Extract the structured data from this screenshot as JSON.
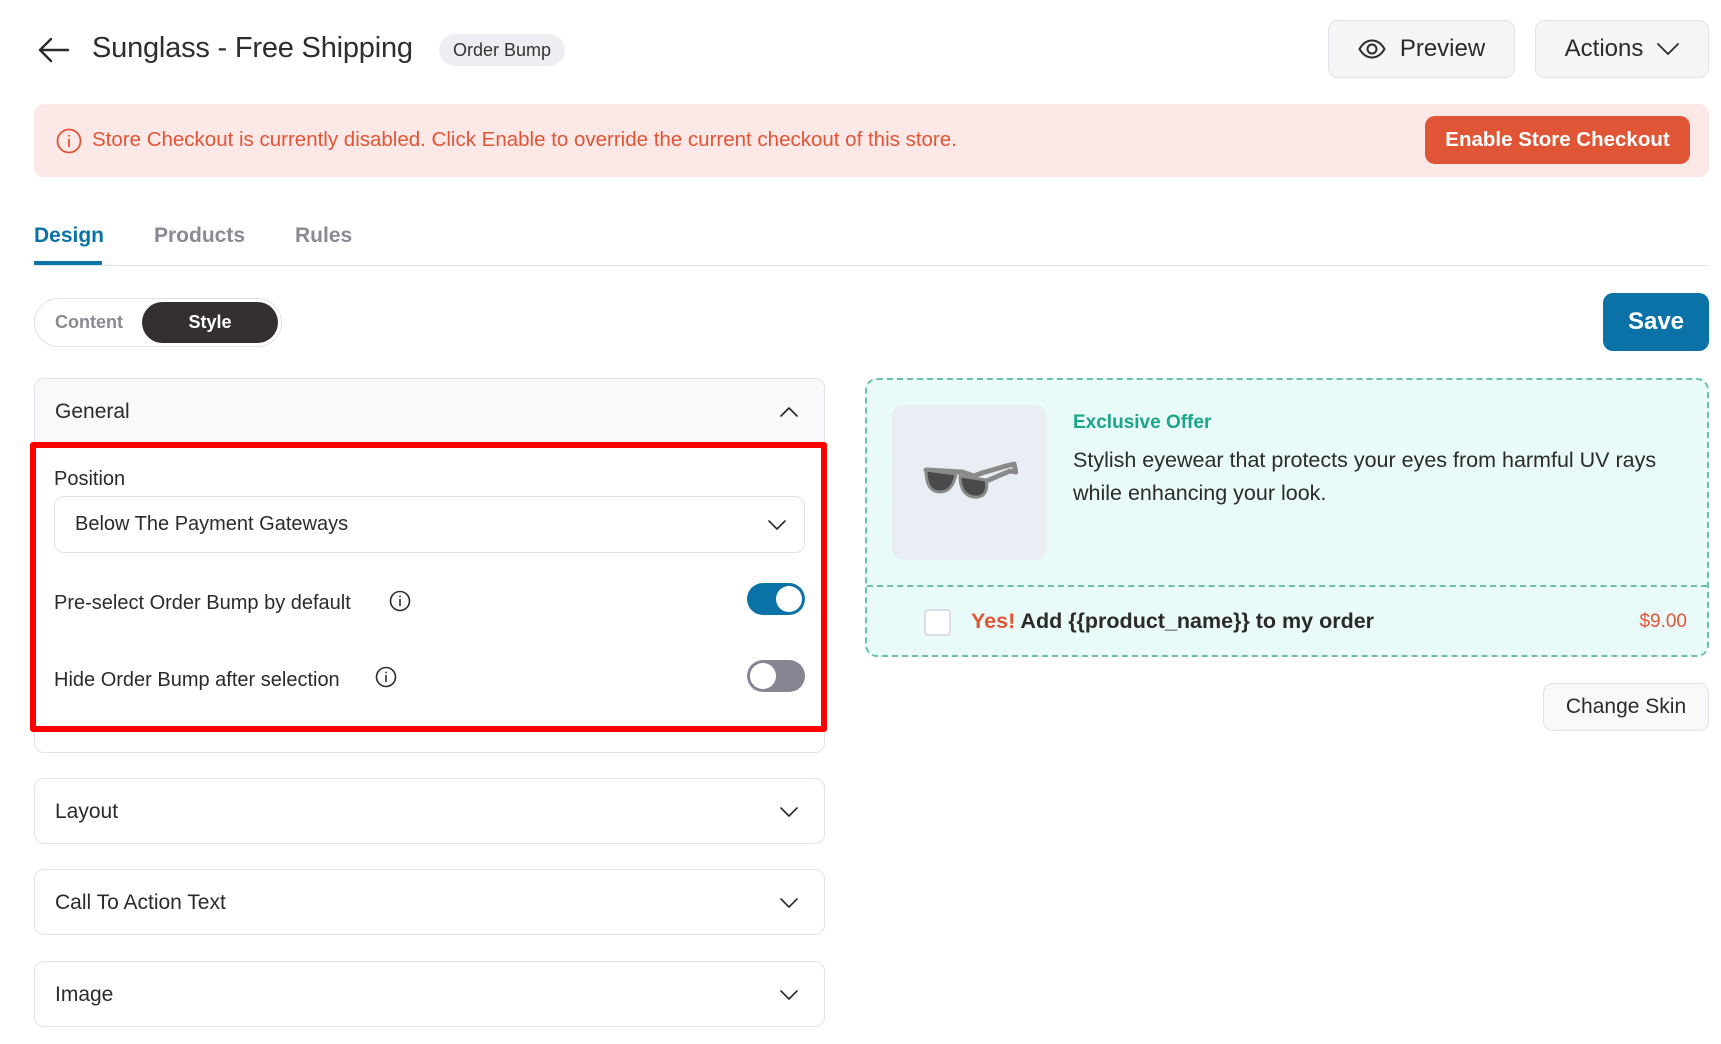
{
  "header": {
    "back_icon": "arrow-left-icon",
    "title": "Sunglass - Free Shipping",
    "badge": "Order Bump",
    "preview_label": "Preview",
    "preview_icon": "eye-icon",
    "actions_label": "Actions",
    "actions_icon": "chevron-down-icon"
  },
  "alert": {
    "icon": "info-circle-icon",
    "message": "Store Checkout is currently disabled. Click Enable to override the current checkout of this store.",
    "button_label": "Enable Store Checkout",
    "color": "#e05535",
    "background": "#fde8e8"
  },
  "tabs": [
    {
      "label": "Design",
      "active": true
    },
    {
      "label": "Products",
      "active": false
    },
    {
      "label": "Rules",
      "active": false
    }
  ],
  "mode_switch": {
    "options": [
      "Content",
      "Style"
    ],
    "selected": "Style"
  },
  "save_label": "Save",
  "panels": {
    "general": {
      "title": "General",
      "expanded": true,
      "position": {
        "label": "Position",
        "value": "Below The Payment Gateways"
      },
      "preselect": {
        "label": "Pre-select Order Bump by default",
        "enabled": true
      },
      "hide_after": {
        "label": "Hide Order Bump after selection",
        "enabled": false
      }
    },
    "layout": {
      "title": "Layout",
      "expanded": false
    },
    "cta": {
      "title": "Call To Action Text",
      "expanded": false
    },
    "image": {
      "title": "Image",
      "expanded": false
    }
  },
  "preview": {
    "product_image": "sunglasses",
    "offer_title": "Exclusive Offer",
    "description": "Stylish eyewear that protects your eyes from harmful UV rays while enhancing your look.",
    "cta_prefix": "Yes!",
    "cta_text": "Add {{product_name}} to my order",
    "price": "$9.00",
    "checked": false,
    "change_skin_label": "Change Skin"
  },
  "colors": {
    "primary": "#0b72a8",
    "danger": "#e05535",
    "accent_green": "#1ba58a",
    "highlight": "#ff0000"
  }
}
